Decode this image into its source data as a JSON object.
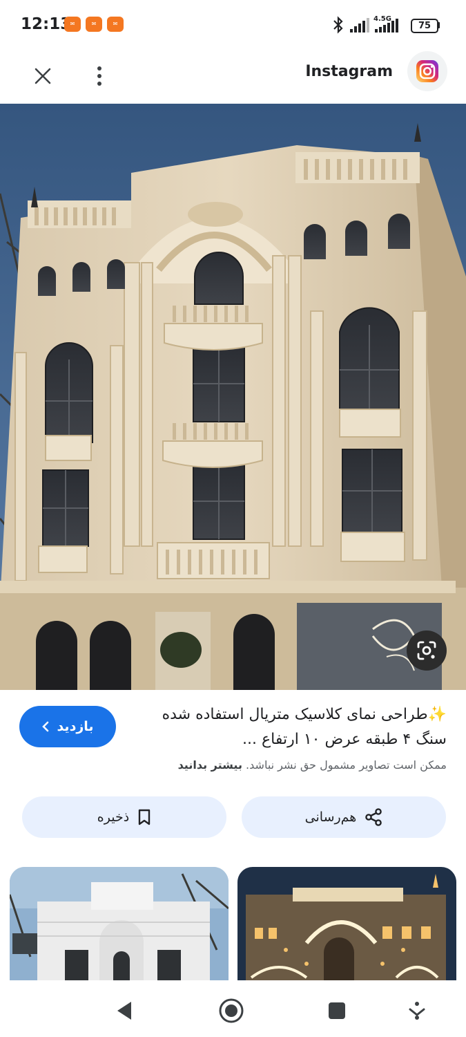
{
  "status_bar": {
    "time": "12:13",
    "notification_icons": [
      "notification-icon",
      "notification-icon",
      "notification-icon"
    ],
    "network_label": "4.5G",
    "battery_level": "75"
  },
  "header": {
    "close_icon": "close-icon",
    "menu_icon": "more-vert-icon",
    "source_title": "Instagram",
    "source_icon": "instagram-icon"
  },
  "image": {
    "lens_icon": "google-lens-icon"
  },
  "caption": {
    "title": "✨طراحی نمای کلاسیک متریال استفاده شده سنگ ۴ طبقه عرض ۱۰ ارتفاع ...",
    "visit_label": "بازدید",
    "copyright_notice": "ممکن است تصاویر مشمول حق نشر نباشد.",
    "learn_more": "بیشتر بدانید"
  },
  "actions": {
    "save_label": "ذخیره",
    "share_label": "هم‌رسانی"
  },
  "colors": {
    "accent": "#1a73e8",
    "pill_bg": "#e8f0fe",
    "notification": "#f47721"
  }
}
